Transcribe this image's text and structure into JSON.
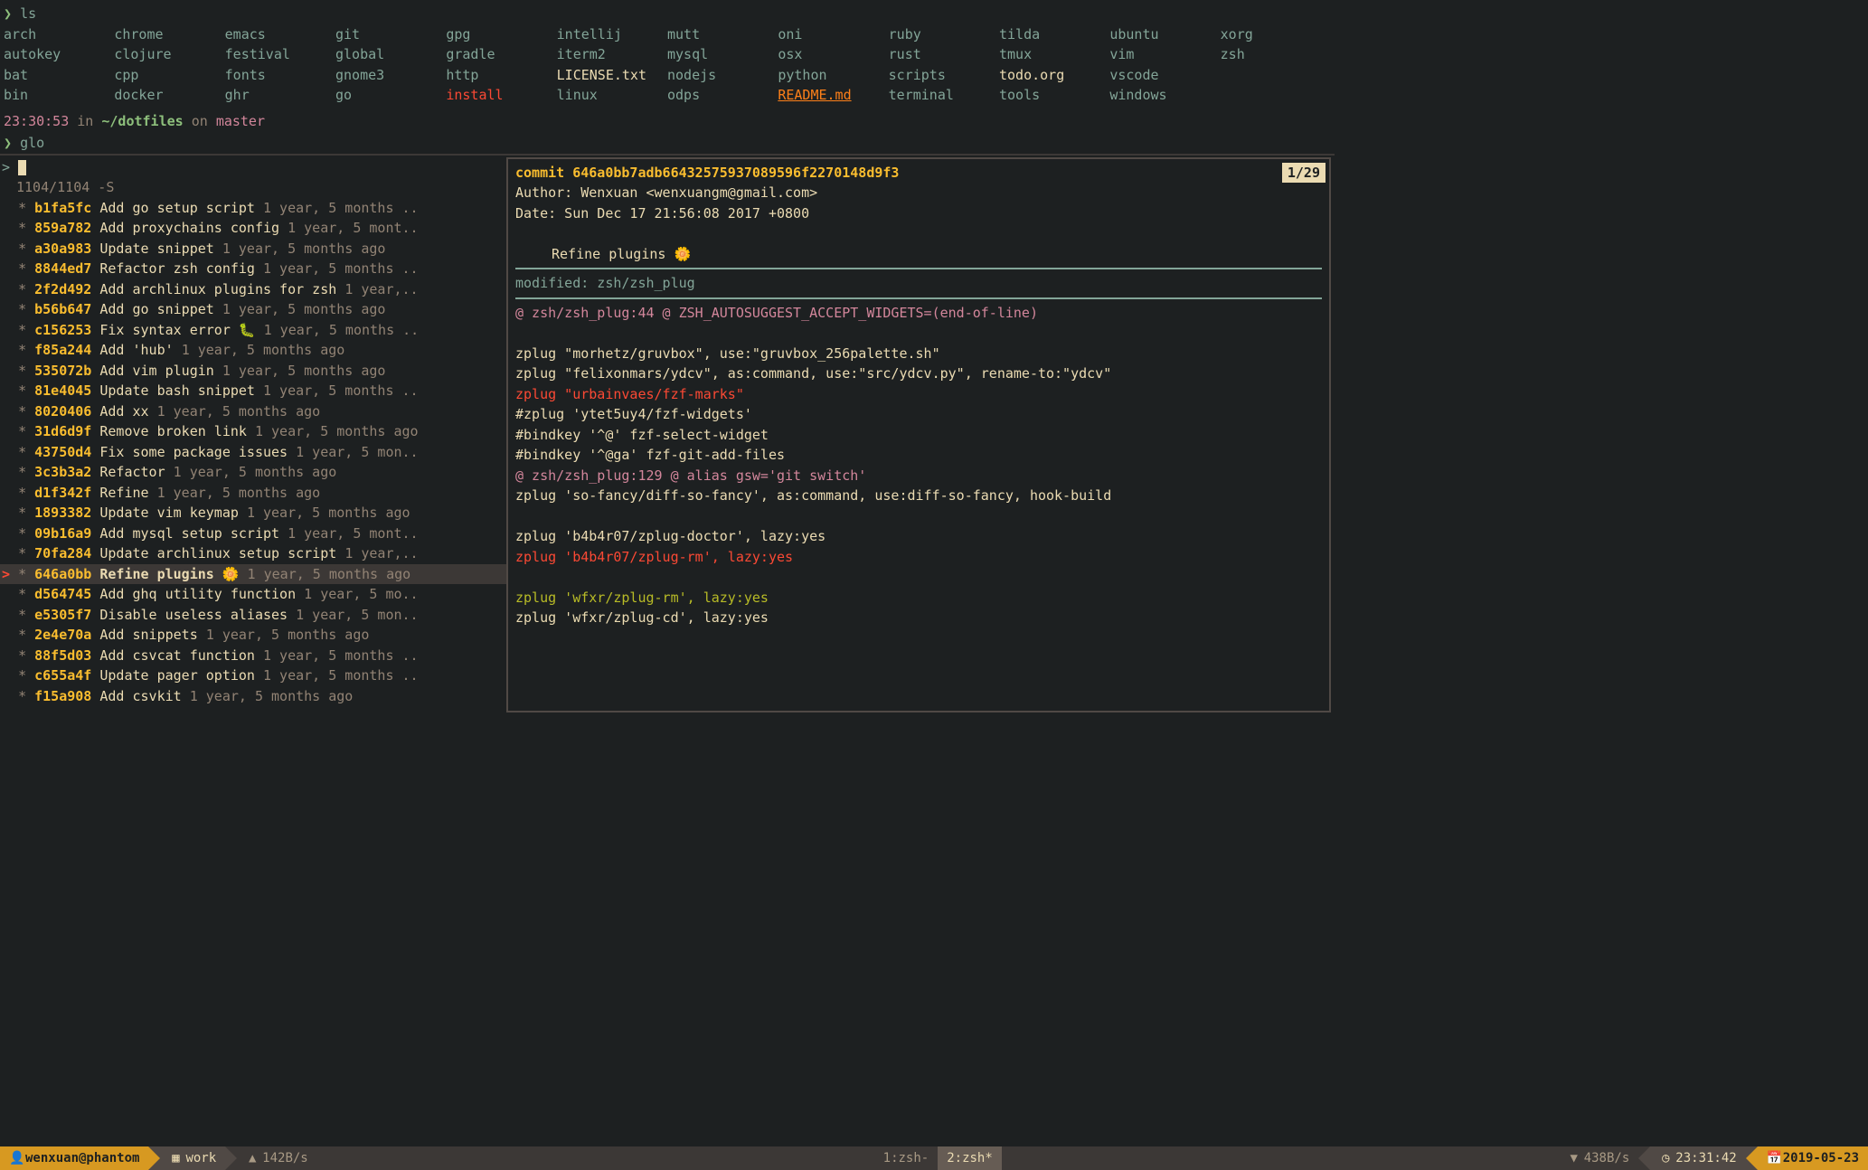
{
  "ls": {
    "cmd": "ls",
    "cols": [
      [
        {
          "n": "arch",
          "t": "dir"
        },
        {
          "n": "autokey",
          "t": "dir"
        },
        {
          "n": "bat",
          "t": "dir"
        },
        {
          "n": "bin",
          "t": "dir"
        }
      ],
      [
        {
          "n": "chrome",
          "t": "dir"
        },
        {
          "n": "clojure",
          "t": "dir"
        },
        {
          "n": "cpp",
          "t": "dir"
        },
        {
          "n": "docker",
          "t": "dir"
        }
      ],
      [
        {
          "n": "emacs",
          "t": "dir"
        },
        {
          "n": "festival",
          "t": "dir"
        },
        {
          "n": "fonts",
          "t": "dir"
        },
        {
          "n": "ghr",
          "t": "dir"
        }
      ],
      [
        {
          "n": "git",
          "t": "dir"
        },
        {
          "n": "global",
          "t": "dir"
        },
        {
          "n": "gnome3",
          "t": "dir"
        },
        {
          "n": "go",
          "t": "dir"
        }
      ],
      [
        {
          "n": "gpg",
          "t": "dir"
        },
        {
          "n": "gradle",
          "t": "dir"
        },
        {
          "n": "http",
          "t": "dir"
        },
        {
          "n": "install",
          "t": "exec"
        }
      ],
      [
        {
          "n": "intellij",
          "t": "dir"
        },
        {
          "n": "iterm2",
          "t": "dir"
        },
        {
          "n": "LICENSE.txt",
          "t": "file"
        },
        {
          "n": "linux",
          "t": "dir"
        }
      ],
      [
        {
          "n": "mutt",
          "t": "dir"
        },
        {
          "n": "mysql",
          "t": "dir"
        },
        {
          "n": "nodejs",
          "t": "dir"
        },
        {
          "n": "odps",
          "t": "dir"
        }
      ],
      [
        {
          "n": "oni",
          "t": "dir"
        },
        {
          "n": "osx",
          "t": "dir"
        },
        {
          "n": "python",
          "t": "dir"
        },
        {
          "n": "README.md",
          "t": "md"
        }
      ],
      [
        {
          "n": "ruby",
          "t": "dir"
        },
        {
          "n": "rust",
          "t": "dir"
        },
        {
          "n": "scripts",
          "t": "dir"
        },
        {
          "n": "terminal",
          "t": "dir"
        }
      ],
      [
        {
          "n": "tilda",
          "t": "dir"
        },
        {
          "n": "tmux",
          "t": "dir"
        },
        {
          "n": "todo.org",
          "t": "file"
        },
        {
          "n": "tools",
          "t": "dir"
        }
      ],
      [
        {
          "n": "ubuntu",
          "t": "dir"
        },
        {
          "n": "vim",
          "t": "dir"
        },
        {
          "n": "vscode",
          "t": "dir"
        },
        {
          "n": "windows",
          "t": "dir"
        }
      ],
      [
        {
          "n": "xorg",
          "t": "dir"
        },
        {
          "n": "zsh",
          "t": "dir"
        }
      ]
    ]
  },
  "prompt": {
    "time": "23:30:53",
    "in": " in ",
    "path": "~/dotfiles",
    "on": " on ",
    "branch_sym": "",
    "branch": " master",
    "cmd2": "glo"
  },
  "fzf": {
    "prompt": "> ",
    "count": "1104/1104 -S",
    "preview_pos": "1/29",
    "selected_index": 18,
    "commits": [
      {
        "h": "b1fa5fc",
        "m": "Add go setup script",
        "d": "1 year, 5 months .."
      },
      {
        "h": "859a782",
        "m": "Add proxychains config",
        "d": "1 year, 5 mont.."
      },
      {
        "h": "a30a983",
        "m": "Update snippet",
        "d": "1 year, 5 months ago"
      },
      {
        "h": "8844ed7",
        "m": "Refactor zsh config",
        "d": "1 year, 5 months .."
      },
      {
        "h": "2f2d492",
        "m": "Add archlinux plugins for zsh",
        "d": "1 year,.."
      },
      {
        "h": "b56b647",
        "m": "Add go snippet",
        "d": "1 year, 5 months ago"
      },
      {
        "h": "c156253",
        "m": "Fix syntax error 🐛",
        "d": "1 year, 5 months .."
      },
      {
        "h": "f85a244",
        "m": "Add 'hub'",
        "d": "1 year, 5 months ago"
      },
      {
        "h": "535072b",
        "m": "Add vim plugin",
        "d": "1 year, 5 months ago"
      },
      {
        "h": "81e4045",
        "m": "Update bash snippet",
        "d": "1 year, 5 months .."
      },
      {
        "h": "8020406",
        "m": "Add xx",
        "d": "1 year, 5 months ago"
      },
      {
        "h": "31d6d9f",
        "m": "Remove broken link",
        "d": "1 year, 5 months ago"
      },
      {
        "h": "43750d4",
        "m": "Fix some package issues",
        "d": "1 year, 5 mon.."
      },
      {
        "h": "3c3b3a2",
        "m": "Refactor",
        "d": "1 year, 5 months ago"
      },
      {
        "h": "d1f342f",
        "m": "Refine",
        "d": "1 year, 5 months ago"
      },
      {
        "h": "1893382",
        "m": "Update vim keymap",
        "d": "1 year, 5 months ago"
      },
      {
        "h": "09b16a9",
        "m": "Add mysql setup script",
        "d": "1 year, 5 mont.."
      },
      {
        "h": "70fa284",
        "m": "Update archlinux setup script",
        "d": "1 year,.."
      },
      {
        "h": "646a0bb",
        "m": "Refine plugins 🌼",
        "d": "1 year, 5 months ago"
      },
      {
        "h": "d564745",
        "m": "Add ghq utility function",
        "d": "1 year, 5 mo.."
      },
      {
        "h": "e5305f7",
        "m": "Disable useless aliases",
        "d": "1 year, 5 mon.."
      },
      {
        "h": "2e4e70a",
        "m": "Add snippets",
        "d": "1 year, 5 months ago"
      },
      {
        "h": "88f5d03",
        "m": "Add csvcat function",
        "d": "1 year, 5 months .."
      },
      {
        "h": "c655a4f",
        "m": "Update pager option",
        "d": "1 year, 5 months .."
      },
      {
        "h": "f15a908",
        "m": "Add csvkit",
        "d": "1 year, 5 months ago"
      }
    ]
  },
  "preview": {
    "commit_label": "commit ",
    "commit_hash": "646a0bb7adb66432575937089596f2270148d9f3",
    "author": "Author: Wenxuan <wenxuangm@gmail.com>",
    "date": "Date:   Sun Dec 17 21:56:08 2017 +0800",
    "message": "Refine plugins 🌼",
    "modified": "modified: zsh/zsh_plug",
    "hunk1": "@ zsh/zsh_plug:44 @ ZSH_AUTOSUGGEST_ACCEPT_WIDGETS=(end-of-line)",
    "lines": [
      {
        "t": "ctx",
        "s": "zplug \"morhetz/gruvbox\", use:\"gruvbox_256palette.sh\""
      },
      {
        "t": "ctx",
        "s": "zplug \"felixonmars/ydcv\", as:command, use:\"src/ydcv.py\", rename-to:\"ydcv\""
      },
      {
        "t": "del",
        "s": "zplug \"urbainvaes/fzf-marks\""
      },
      {
        "t": "ctx",
        "s": "#zplug 'ytet5uy4/fzf-widgets'"
      },
      {
        "t": "ctx",
        "s": "#bindkey '^@'  fzf-select-widget"
      },
      {
        "t": "ctx",
        "s": "#bindkey '^@ga' fzf-git-add-files"
      },
      {
        "t": "hunk",
        "s": "@ zsh/zsh_plug:129 @ alias gsw='git switch'"
      },
      {
        "t": "ctx",
        "s": "zplug 'so-fancy/diff-so-fancy', as:command, use:diff-so-fancy, hook-build"
      },
      {
        "t": "blank",
        "s": ""
      },
      {
        "t": "ctx",
        "s": "zplug 'b4b4r07/zplug-doctor', lazy:yes"
      },
      {
        "t": "del",
        "s": "zplug 'b4b4r07/zplug-rm', lazy:yes"
      },
      {
        "t": "blank",
        "s": ""
      },
      {
        "t": "add",
        "s": "zplug 'wfxr/zplug-rm', lazy:yes"
      },
      {
        "t": "ctx",
        "s": "zplug 'wfxr/zplug-cd', lazy:yes"
      }
    ]
  },
  "statusbar": {
    "user": "wenxuan@phantom",
    "session": "work",
    "up": "142B/s",
    "win1": "1:zsh-",
    "win2": "2:zsh*",
    "down": "438B/s",
    "clock": "23:31:42",
    "date": "2019-05-23"
  }
}
